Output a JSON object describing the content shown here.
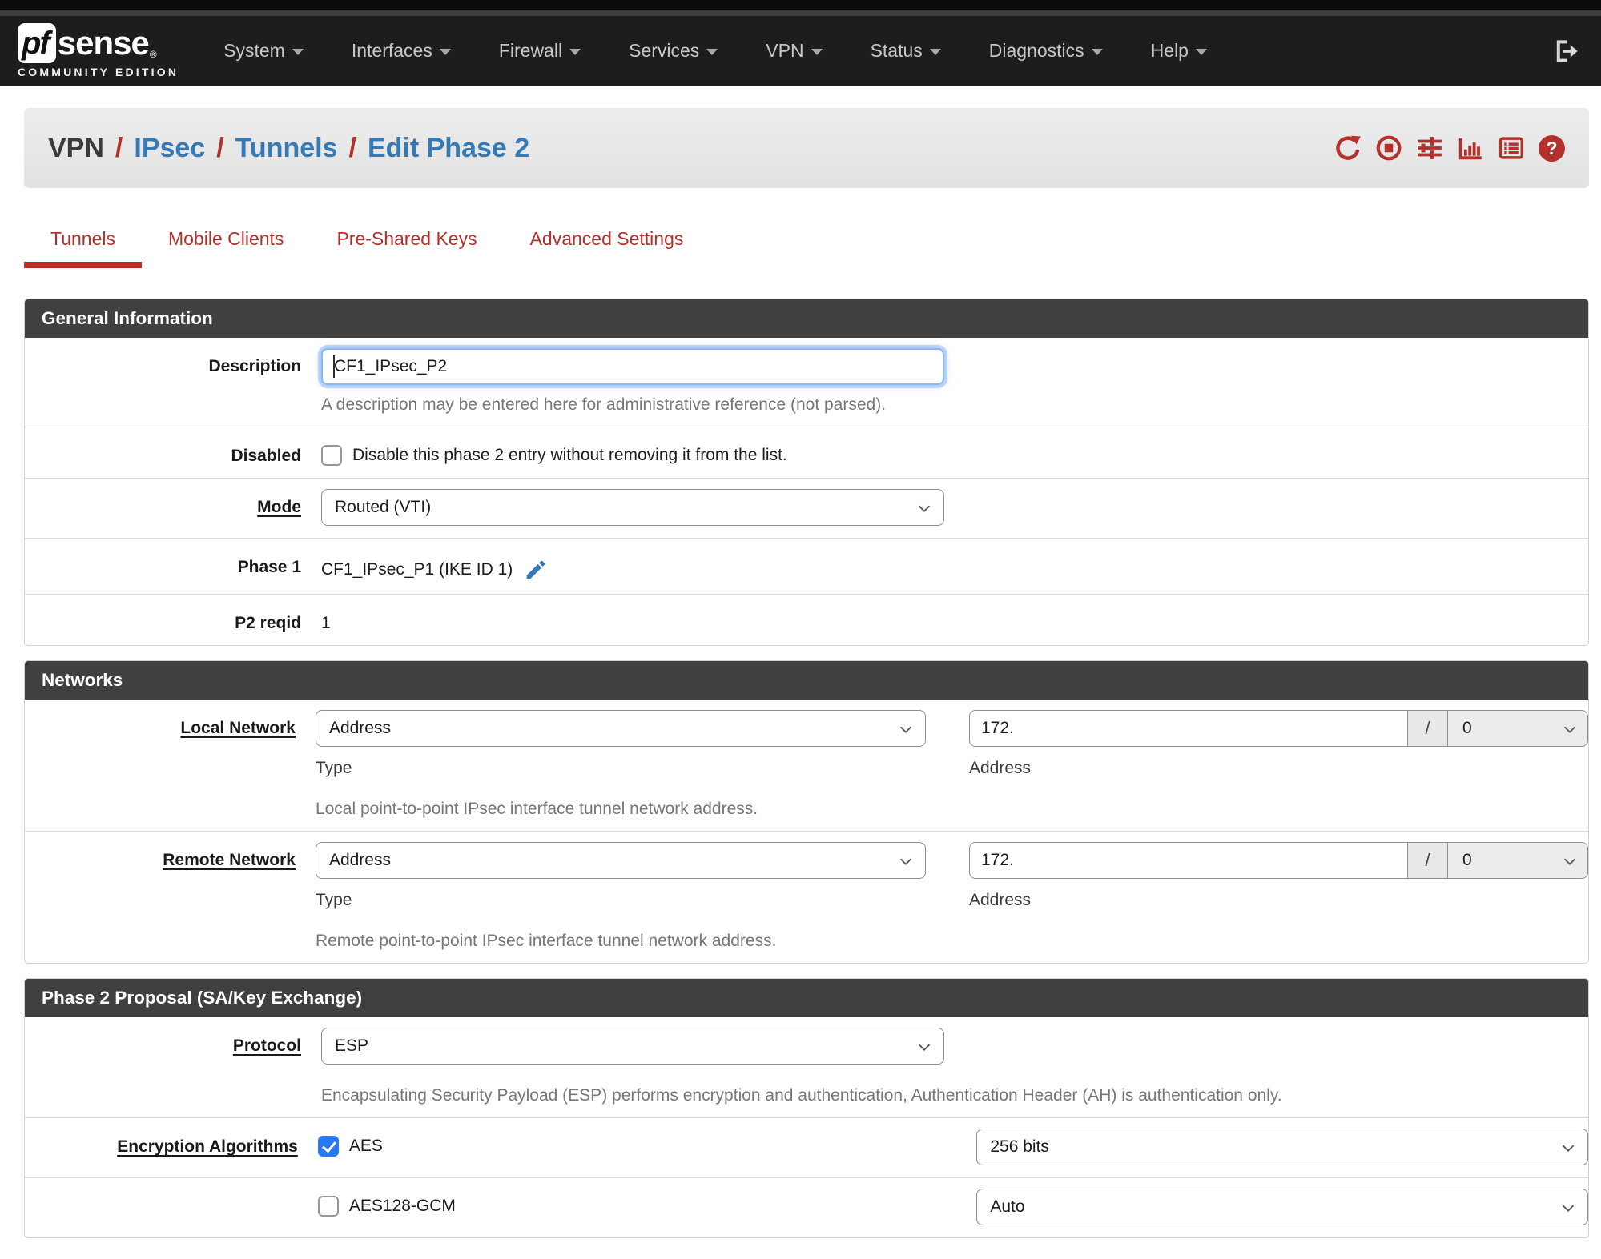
{
  "navbar": {
    "logo": {
      "pf": "pf",
      "sense": "sense",
      "reg": "®",
      "subtitle": "COMMUNITY EDITION"
    },
    "items": [
      {
        "label": "System"
      },
      {
        "label": "Interfaces"
      },
      {
        "label": "Firewall"
      },
      {
        "label": "Services"
      },
      {
        "label": "VPN"
      },
      {
        "label": "Status"
      },
      {
        "label": "Diagnostics"
      },
      {
        "label": "Help"
      }
    ],
    "icons": [
      "logout-icon"
    ]
  },
  "breadcrumb": {
    "segments": [
      {
        "label": "VPN",
        "type": "plain"
      },
      {
        "label": "IPsec",
        "type": "link"
      },
      {
        "label": "Tunnels",
        "type": "link"
      },
      {
        "label": "Edit Phase 2",
        "type": "link"
      }
    ],
    "separator": "/",
    "icons": [
      "refresh-icon",
      "stop-icon",
      "sliders-icon",
      "bar-chart-icon",
      "log-list-icon",
      "help-icon"
    ],
    "help_glyph": "?"
  },
  "tabs": [
    {
      "label": "Tunnels",
      "active": true
    },
    {
      "label": "Mobile Clients",
      "active": false
    },
    {
      "label": "Pre-Shared Keys",
      "active": false
    },
    {
      "label": "Advanced Settings",
      "active": false
    }
  ],
  "general": {
    "title": "General Information",
    "description_label": "Description",
    "description_value": "CF1_IPsec_P2",
    "description_help": "A description may be entered here for administrative reference (not parsed).",
    "disabled_label": "Disabled",
    "disabled_checkbox_label": "Disable this phase 2 entry without removing it from the list.",
    "disabled_checked": false,
    "mode_label": "Mode",
    "mode_value": "Routed (VTI)",
    "phase1_label": "Phase 1",
    "phase1_value": "CF1_IPsec_P1 (IKE ID 1)",
    "p2reqid_label": "P2 reqid",
    "p2reqid_value": "1"
  },
  "networks": {
    "title": "Networks",
    "local": {
      "label": "Local Network",
      "type_value": "Address",
      "type_caption": "Type",
      "address_value": "172.",
      "slash": "/",
      "prefix_value": "0",
      "address_caption": "Address",
      "help": "Local point-to-point IPsec interface tunnel network address."
    },
    "remote": {
      "label": "Remote Network",
      "type_value": "Address",
      "type_caption": "Type",
      "address_value": "172.",
      "slash": "/",
      "prefix_value": "0",
      "address_caption": "Address",
      "help": "Remote point-to-point IPsec interface tunnel network address."
    }
  },
  "proposal": {
    "title": "Phase 2 Proposal (SA/Key Exchange)",
    "protocol_label": "Protocol",
    "protocol_value": "ESP",
    "protocol_help": "Encapsulating Security Payload (ESP) performs encryption and authentication, Authentication Header (AH) is authentication only.",
    "encryption_label": "Encryption Algorithms",
    "algorithms": [
      {
        "name": "AES",
        "checked": true,
        "bits": "256 bits"
      },
      {
        "name": "AES128-GCM",
        "checked": false,
        "bits": "Auto"
      }
    ]
  },
  "colors": {
    "accent_red": "#b3302b",
    "link_blue": "#337ab7",
    "navbar_bg": "#1d1d1d",
    "panel_header_bg": "#404040",
    "checkbox_blue": "#2979f2",
    "focus_ring_blue": "#8ab9f2"
  }
}
